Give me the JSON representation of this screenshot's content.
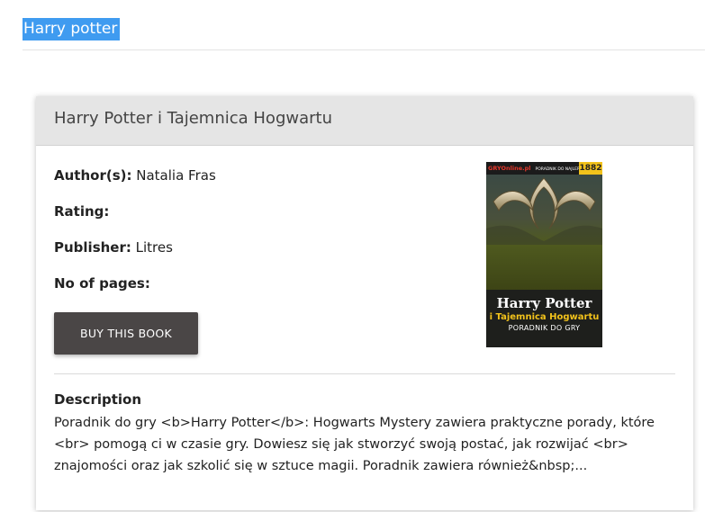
{
  "search": {
    "term": "Harry potter"
  },
  "book": {
    "title": "Harry Potter i Tajemnica Hogwartu",
    "author_label": "Author(s):",
    "author": "Natalia Fras",
    "rating_label": "Rating:",
    "rating": "",
    "publisher_label": "Publisher:",
    "publisher": "Litres",
    "pages_label": "No of pages:",
    "pages": "",
    "buy_label": "BUY THIS BOOK",
    "description_label": "Description",
    "description": "Poradnik do gry <b>Harry Potter</b>: Hogwarts Mystery zawiera praktyczne porady, które <br> pomogą ci w czasie gry. Dowiesz się jak stworzyć swoją postać, jak rozwijać <br> znajomości oraz jak szkolić się w sztuce magii. Poradnik zawiera również&nbsp;...",
    "cover": {
      "brand": "GRYOnline.pl",
      "series": "PORADNIK DO NAJLEPSZYCH GIER",
      "number": "1882",
      "title_line1": "Harry Potter",
      "title_line2": "i Tajemnica Hogwartu",
      "title_line3": "PORADNIK DO GRY"
    }
  },
  "colors": {
    "selection": "#3f9bf0",
    "header_bg": "#e5e5e5",
    "button_bg": "#4a4646"
  }
}
